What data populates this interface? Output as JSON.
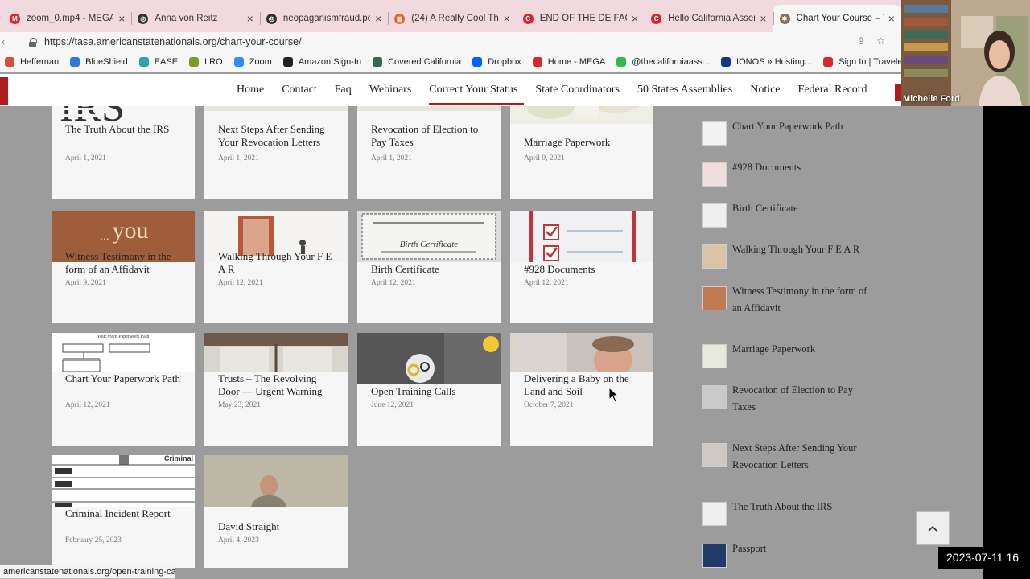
{
  "browser": {
    "tabs": [
      {
        "title": "zoom_0.mp4 - MEGA",
        "color": "#d9262c",
        "glyph": "M"
      },
      {
        "title": "Anna von Reitz",
        "color": "#333333",
        "glyph": "◎"
      },
      {
        "title": "neopaganismfraud.pdf",
        "color": "#333333",
        "glyph": "◎"
      },
      {
        "title": "(24) A Really Cool Thi",
        "color": "#e0682b",
        "glyph": "▤"
      },
      {
        "title": "END OF THE DE FACTO",
        "color": "#d9262c",
        "glyph": "C"
      },
      {
        "title": "Hello California Assem",
        "color": "#d9262c",
        "glyph": "C"
      },
      {
        "title": "Chart Your Course – T",
        "color": "#8a6d5a",
        "glyph": "✱"
      }
    ],
    "url": "https://tasa.americanstatenationals.org/chart-your-course/",
    "bookmarks": [
      {
        "label": "Heffernan",
        "color": "#d2523c"
      },
      {
        "label": "BlueShield",
        "color": "#2f7bd4"
      },
      {
        "label": "EASE",
        "color": "#2aa6a6"
      },
      {
        "label": "LRO",
        "color": "#7a9c24"
      },
      {
        "label": "Zoom",
        "color": "#2d8cff"
      },
      {
        "label": "Amazon Sign-In",
        "color": "#222222"
      },
      {
        "label": "Covered California",
        "color": "#2c6e49"
      },
      {
        "label": "Dropbox",
        "color": "#0061fe"
      },
      {
        "label": "Home - MEGA",
        "color": "#d9262c"
      },
      {
        "label": "@thecaliforniaass...",
        "color": "#39b54a"
      },
      {
        "label": "IONOS » Hosting...",
        "color": "#11388c"
      },
      {
        "label": "Sign In | Travelers...",
        "color": "#d9262c"
      }
    ],
    "status_url": "americanstatenationals.org/open-training-calls/"
  },
  "nav": {
    "links": [
      "Home",
      "Contact",
      "Faq",
      "Webinars",
      "Correct Your Status",
      "State Coordinators",
      "50 States Assemblies",
      "Notice",
      "Federal Record"
    ]
  },
  "posts": [
    {
      "title": "The Truth About the IRS",
      "date": "April 1, 2021",
      "thumb": "irs-logo-image"
    },
    {
      "title": "Next Steps After Sending Your Revocation Letters",
      "date": "April 1, 2021",
      "thumb": "hands-image"
    },
    {
      "title": "Revocation of Election to Pay Taxes",
      "date": "April 1, 2021",
      "thumb": "hands-image"
    },
    {
      "title": "Marriage Paperwork",
      "date": "April 9, 2021",
      "thumb": "wedding-image"
    },
    {
      "title": "Witness Testimony in the form of an Affidavit",
      "date": "April 9, 2021",
      "thumb": "you-image",
      "thumb_text": "you"
    },
    {
      "title": "Walking Through Your F E A R",
      "date": "April 12, 2021",
      "thumb": "door-image"
    },
    {
      "title": "Birth Certificate",
      "date": "April 12, 2021",
      "thumb": "certificate-image",
      "thumb_text": "Birth Certificate"
    },
    {
      "title": "#928 Documents",
      "date": "April 12, 2021",
      "thumb": "checklist-image"
    },
    {
      "title": "Chart Your Paperwork Path",
      "date": "April 12, 2021",
      "thumb": "flowchart-image",
      "thumb_text": "Your #928 Paperwork Path"
    },
    {
      "title": "Trusts – The Revolving Door — Urgent Warning",
      "date": "May 23, 2021",
      "thumb": "revolving-door-image"
    },
    {
      "title": "Open Training Calls",
      "date": "June 12, 2021",
      "thumb": "lightbulb-image"
    },
    {
      "title": "Delivering a Baby on the Land and Soil",
      "date": "October 7, 2021",
      "thumb": "baby-image"
    },
    {
      "title": "Criminal Incident Report",
      "date": "February 25, 2023",
      "thumb": "form-image",
      "thumb_text": "Criminal"
    },
    {
      "title": "David Straight",
      "date": "April 4, 2023",
      "thumb": "speaker-image"
    }
  ],
  "sidebar": {
    "items": [
      {
        "label": "Chart Your Paperwork Path"
      },
      {
        "label": "#928 Documents"
      },
      {
        "label": "Birth Certificate"
      },
      {
        "label": "Walking Through Your F E A R"
      },
      {
        "label": "Witness Testimony in the form of an Affidavit"
      },
      {
        "label": "Marriage Paperwork"
      },
      {
        "label": "Revocation of Election to Pay Taxes"
      },
      {
        "label": "Next Steps After Sending Your Revocation Letters"
      },
      {
        "label": "The Truth About the IRS"
      },
      {
        "label": "Passport"
      }
    ]
  },
  "scroll_top_icon": "chevron-up-icon",
  "video": {
    "participant_name": "Michelle Ford"
  },
  "timestamp": "2023-07-11 16"
}
